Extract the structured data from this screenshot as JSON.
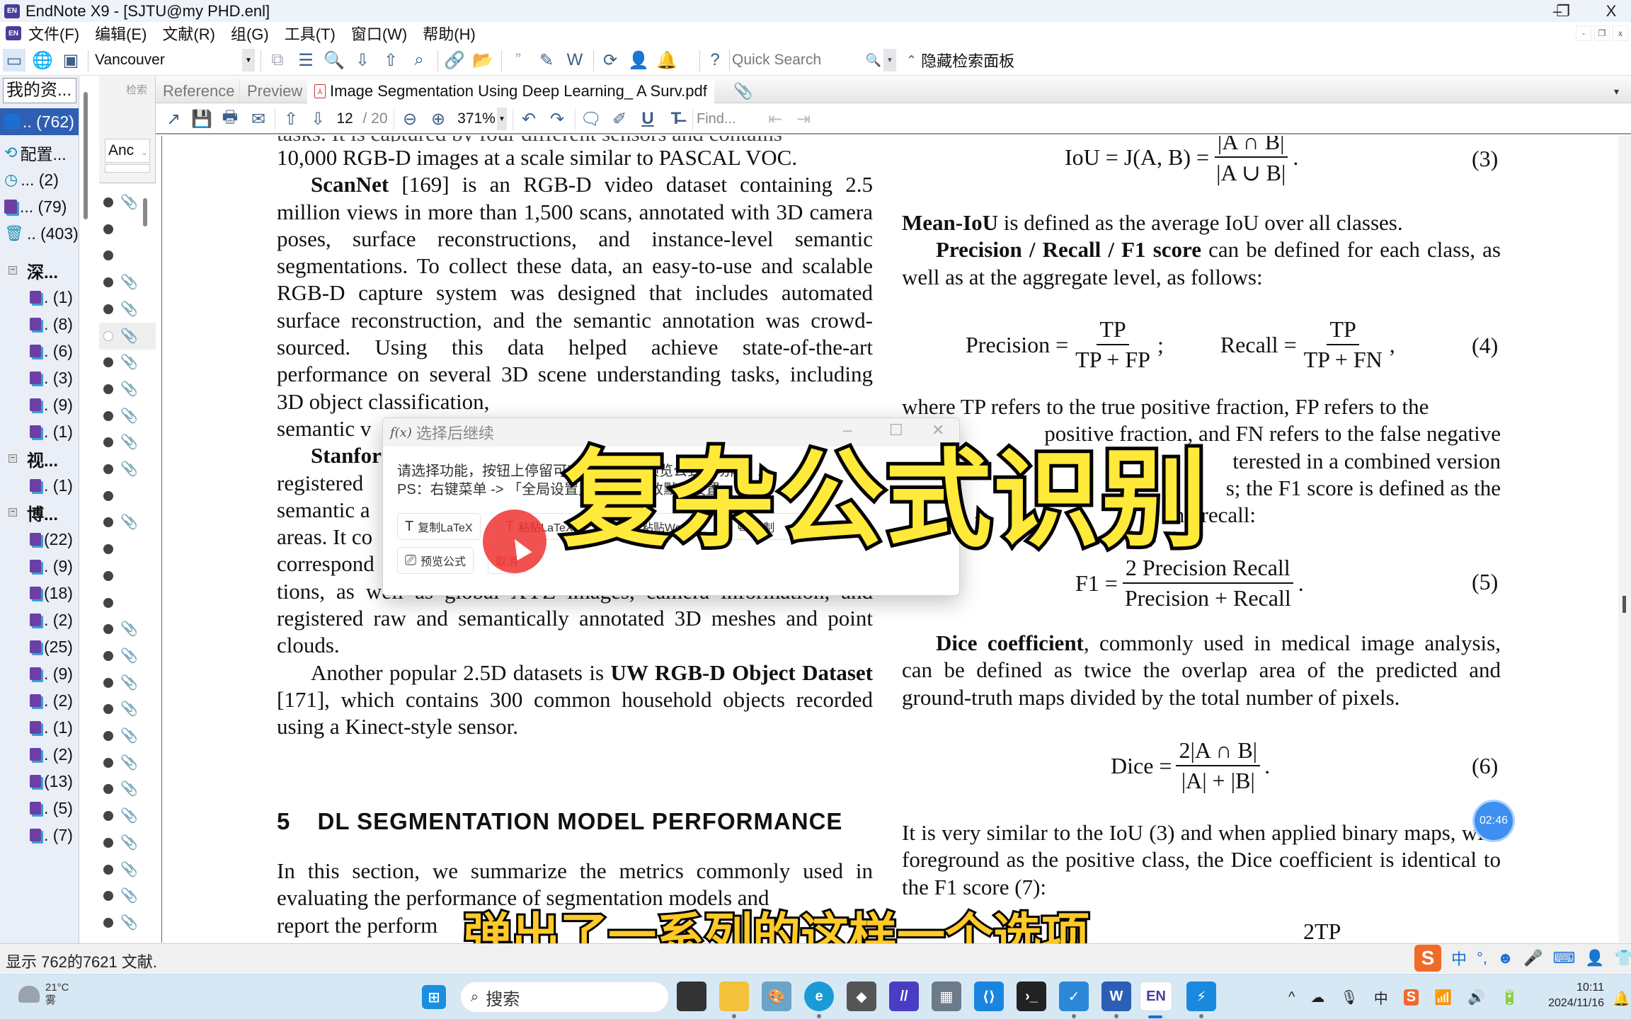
{
  "window": {
    "title": "EndNote X9 - [SJTU@my PHD.enl]",
    "app_icon": "EN",
    "controls": {
      "minimize": "–",
      "restore": "❐",
      "close": "X"
    }
  },
  "menubar": {
    "items": [
      "文件(F)",
      "编辑(E)",
      "文献(R)",
      "组(G)",
      "工具(T)",
      "窗口(W)",
      "帮助(H)"
    ],
    "mdi_controls": {
      "minimize": "-",
      "restore": "❐",
      "close": "x"
    }
  },
  "toolbar": {
    "style_select": "Vancouver",
    "quick_search_placeholder": "Quick Search",
    "hide_panel_label": "隐藏检索面板",
    "icons": [
      "local-library-icon",
      "online-search-icon",
      "integrated-library-icon",
      "copy-to-library-icon",
      "new-reference-icon",
      "online-search-magnifier-icon",
      "import-icon",
      "export-icon",
      "find-fulltext-icon",
      "open-link-icon",
      "open-file-icon",
      "insert-citation-icon",
      "format-bibliography-icon",
      "word-icon",
      "sync-icon",
      "share-icon",
      "activity-icon",
      "help-icon"
    ]
  },
  "groups_panel": {
    "header": "我的资...",
    "items": [
      {
        "label": ".. (762)",
        "icon": "all-references-icon",
        "selected": true
      },
      {
        "label": "配置...",
        "icon": "sync-config-icon"
      },
      {
        "label": "...  (2)",
        "icon": "recently-added-icon"
      },
      {
        "label": "...  (79)",
        "icon": "unfiled-icon"
      },
      {
        "label": ".. (403)",
        "icon": "trash-icon"
      }
    ],
    "group_sets": [
      {
        "name": "深...",
        "groups": [
          ". (1)",
          ". (8)",
          ". (6)",
          ". (3)",
          ". (9)",
          ". (1)"
        ]
      },
      {
        "name": "视...",
        "groups": [
          ". (1)"
        ]
      },
      {
        "name": "博...",
        "groups": [
          "(22)",
          ". (9)",
          "(18)",
          ". (2)",
          "(25)",
          ". (9)",
          ". (2)",
          ". (1)",
          ". (2)",
          "(13)",
          ". (5)",
          ". (7)"
        ]
      }
    ]
  },
  "ref_panel": {
    "search_label": "检索",
    "field_select": "Anc",
    "rows": [
      {
        "read": true,
        "attachment": true
      },
      {
        "read": true,
        "attachment": false
      },
      {
        "read": true,
        "attachment": false
      },
      {
        "read": true,
        "attachment": true
      },
      {
        "read": true,
        "attachment": true
      },
      {
        "read": false,
        "attachment": true
      },
      {
        "read": true,
        "attachment": true
      },
      {
        "read": true,
        "attachment": true
      },
      {
        "read": true,
        "attachment": true
      },
      {
        "read": true,
        "attachment": true
      },
      {
        "read": true,
        "attachment": true
      },
      {
        "read": true,
        "attachment": false
      },
      {
        "read": true,
        "attachment": true
      },
      {
        "read": true,
        "attachment": false
      },
      {
        "read": true,
        "attachment": false
      },
      {
        "read": true,
        "attachment": false
      },
      {
        "read": true,
        "attachment": true
      },
      {
        "read": true,
        "attachment": true
      },
      {
        "read": true,
        "attachment": true
      },
      {
        "read": true,
        "attachment": true
      },
      {
        "read": true,
        "attachment": true
      },
      {
        "read": true,
        "attachment": true
      },
      {
        "read": true,
        "attachment": true
      },
      {
        "read": true,
        "attachment": true
      },
      {
        "read": true,
        "attachment": true
      },
      {
        "read": true,
        "attachment": true
      },
      {
        "read": true,
        "attachment": true
      },
      {
        "read": true,
        "attachment": true
      }
    ]
  },
  "tabs": {
    "items": [
      "Reference",
      "Preview",
      "Image Segmentation Using Deep Learning_ A Surv.pdf"
    ],
    "active": 2
  },
  "pdf_toolbar": {
    "current_page": "12",
    "total_pages": "/ 20",
    "zoom": "371%",
    "find_placeholder": "Find..."
  },
  "pdf": {
    "left_column": {
      "cut_line": "tasks. It is captured by four different sensors and contains",
      "p1_tail": "10,000 RGB-D images at a scale similar to PASCAL VOC.",
      "scannet_bold": "ScanNet",
      "scannet_text": " [169] is an RGB-D video dataset containing 2.5 million views in more than 1,500 scans, annotated with 3D camera poses, surface reconstructions, and instance-level semantic segmentations. To collect these data, an easy-to-use and scalable RGB-D capture system was designed that includes automated surface reconstruction, and the semantic annotation was crowd-sourced. Using this data helped achieve state-of-the-art performance on several 3D scene understanding tasks, including 3D object classification,",
      "scannet_last": "semantic v",
      "stanford_lines": [
        "Stanfor",
        "registered",
        "semantic a",
        "areas. It co",
        "correspond"
      ],
      "after_dialog": "tions, as well as global XYZ images, camera information, and registered raw and semantically annotated 3D meshes and point clouds.",
      "uw_text_1": "Another popular 2.5D datasets is ",
      "uw_bold": "UW RGB-D Object Dataset",
      "uw_text_2": " [171], which contains 300 common household objects recorded using a Kinect-style sensor.",
      "section_number": "5",
      "section_title": "DL SEGMENTATION MODEL PERFORMANCE",
      "section_text": "In this section, we summarize the metrics commonly used in evaluating the performance of segmentation models and",
      "section_last": "report the perform"
    },
    "right_column": {
      "eq3_lhs": "IoU = J(A, B) =",
      "eq3_num": "|A ∩ B|",
      "eq3_den": "|A ∪ B|",
      "eq3_tag": "(3)",
      "meaniou_bold": "Mean-IoU",
      "meaniou_text": " is defined as the average IoU over all classes.",
      "prf_bold": "Precision / Recall / F1 score",
      "prf_text": " can be defined for each class, as well as at the aggregate level, as follows:",
      "eq4_prec": "Precision =",
      "eq4_num": "TP",
      "eq4_prec_den": "TP + FP",
      "eq4_rec": "Recall =",
      "eq4_rec_den": "TP + FN",
      "eq4_tag": "(4)",
      "where_text": "where TP refers to the true positive fraction, FP refers to the",
      "where_lines": [
        "positive fraction, and FN refers to the false negative",
        "terested in a combined version",
        "s; the F1 score is defined as the",
        "and recall:"
      ],
      "eq5_lhs": "F1 =",
      "eq5_num": "2 Precision Recall",
      "eq5_den": "Precision + Recall",
      "eq5_tag": "(5)",
      "dice_bold": "Dice coefficient",
      "dice_text": ", commonly used in medical image analysis, can be defined as twice the overlap area of the predicted and ground-truth maps divided by the total number of pixels.",
      "eq6_lhs": "Dice =",
      "eq6_num": "2|A ∩ B|",
      "eq6_den": "|A| + |B|",
      "eq6_tag": "(6)",
      "similar_text": "It is very similar to the IoU (3) and when applied binary maps, with foreground as the positive class, the Dice coefficient is identical to the F1 score (7):",
      "eq7_num": "2TP"
    }
  },
  "dialog": {
    "title": "选择后继续",
    "message_line1": "请选择功能，按钮上停留可查看说明，「预览公式」功能",
    "message_line2": "PS：右键菜单 -> 「全局设置」中可以更改默认设置",
    "buttons": [
      {
        "label": "复制LaTeX",
        "icon": "text-icon"
      },
      {
        "label": "粘贴LaTeX",
        "icon": "text-icon"
      },
      {
        "label": "粘贴Word",
        "icon": "word-icon"
      },
      {
        "label": "复制",
        "icon": "copy-icon"
      },
      {
        "label": "预览公式",
        "icon": "monitor-icon"
      },
      {
        "label": "取消",
        "icon": ""
      }
    ],
    "controls": {
      "minimize": "–",
      "maximize": "☐",
      "close": "✕"
    }
  },
  "overlay": {
    "caption_big": "复杂公式识别",
    "caption_sub": "弹出了一系列的这样一个选项",
    "timer": "02:46"
  },
  "statusbar": {
    "text": "显示 762的7621 文献."
  },
  "ime": {
    "items": [
      "中",
      "°,",
      "☻",
      "🎤",
      "⌨",
      "👤",
      "👕",
      "⊞"
    ]
  },
  "taskbar": {
    "weather_temp": "21°C",
    "weather_desc": "雾",
    "search_placeholder": "搜索",
    "apps": [
      "task-view",
      "file-explorer",
      "paint",
      "edge",
      "obsidian",
      "maple",
      "calculator",
      "code-app",
      "terminal",
      "todo",
      "word",
      "endnote",
      "thunder"
    ],
    "tray": [
      "^",
      "☁",
      "🎙",
      "中",
      "S",
      "wifi",
      "🔊",
      "🔋"
    ],
    "time": "10:11",
    "date": "2024/11/16"
  },
  "colors": {
    "selection_blue": "#2f5fb3",
    "caption_yellow": "#ffe93a",
    "subtitle_yellow": "#ffc928",
    "click_red": "#f03232",
    "taskbar_bg": "#d7e8f5"
  }
}
